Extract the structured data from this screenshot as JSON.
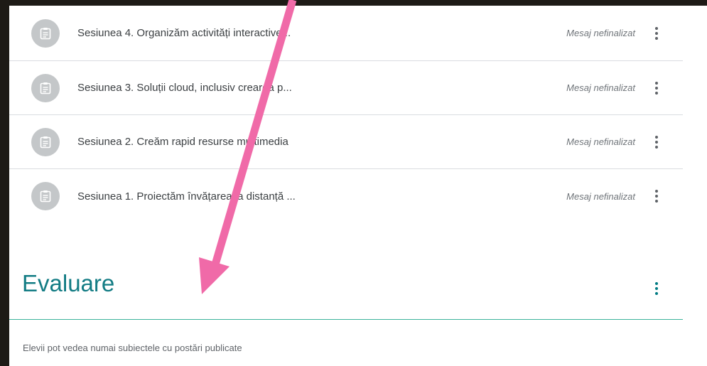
{
  "posts": [
    {
      "title": "Sesiunea 4. Organizăm activități interactive...",
      "status": "Mesaj nefinalizat",
      "icon": "assignment-icon"
    },
    {
      "title": "Sesiunea 3. Soluții cloud, inclusiv crearea p...",
      "status": "Mesaj nefinalizat",
      "icon": "assignment-icon"
    },
    {
      "title": "Sesiunea 2. Creăm rapid resurse multimedia",
      "status": "Mesaj nefinalizat",
      "icon": "assignment-icon"
    },
    {
      "title": "Sesiunea 1. Proiectăm învățarea la distanță ...",
      "status": "Mesaj nefinalizat",
      "icon": "assignment-icon"
    }
  ],
  "topic": {
    "title": "Evaluare",
    "note": "Elevii pot vedea numai subiectele cu postări publicate"
  },
  "colors": {
    "accent": "#137c84",
    "divider_accent": "#3cb39b",
    "annotation_arrow": "#f06aa8"
  }
}
